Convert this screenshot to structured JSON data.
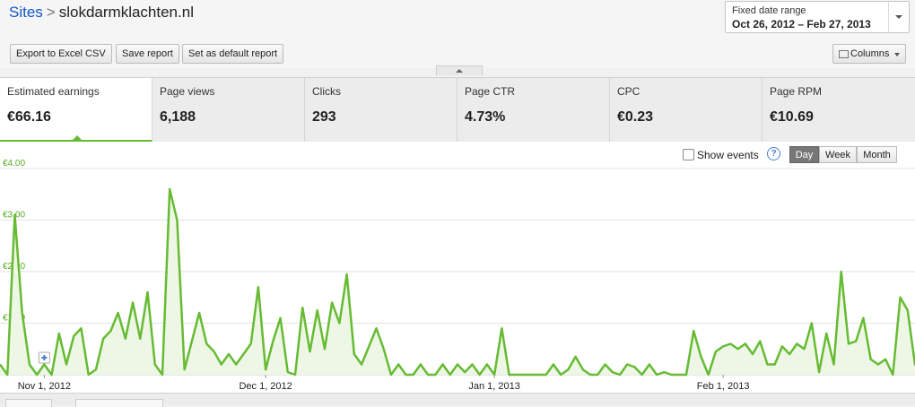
{
  "breadcrumb": {
    "root": "Sites",
    "separator": ">",
    "current": "slokdarmklachten.nl"
  },
  "date_range": {
    "label": "Fixed date range",
    "value": "Oct 26, 2012 – Feb 27, 2013"
  },
  "toolbar": {
    "export_label": "Export to Excel CSV",
    "save_label": "Save report",
    "default_label": "Set as default report",
    "columns_label": "Columns"
  },
  "metrics": [
    {
      "label": "Estimated earnings",
      "value": "€66.16",
      "active": true
    },
    {
      "label": "Page views",
      "value": "6,188",
      "active": false
    },
    {
      "label": "Clicks",
      "value": "293",
      "active": false
    },
    {
      "label": "Page CTR",
      "value": "4.73%",
      "active": false
    },
    {
      "label": "CPC",
      "value": "€0.23",
      "active": false
    },
    {
      "label": "Page RPM",
      "value": "€10.69",
      "active": false
    }
  ],
  "chart_controls": {
    "show_events_label": "Show events",
    "help_glyph": "?",
    "granularity": [
      "Day",
      "Week",
      "Month"
    ],
    "selected_granularity": "Day"
  },
  "colors": {
    "accent": "#66bb33",
    "fill": "#eef7e6",
    "link": "#1155cc"
  },
  "icons": {
    "help": "help-icon",
    "columns": "columns-icon",
    "dropdown": "chevron-down-icon",
    "collapse": "chevron-up-icon"
  },
  "chart_data": {
    "type": "area",
    "x_start": "2012-10-26",
    "x_end": "2013-02-27",
    "xtick_labels": [
      "Nov 1, 2012",
      "Dec 1, 2012",
      "Jan 1, 2013",
      "Feb 1, 2013"
    ],
    "xtick_dates": [
      "2012-11-01",
      "2012-12-01",
      "2013-01-01",
      "2013-02-01"
    ],
    "ytick_labels": [
      "€1.00",
      "€2.00",
      "€3.00",
      "€4.00"
    ],
    "ylim": [
      0,
      4.2
    ],
    "grid": true,
    "series": [
      {
        "values": [
          0.2,
          0,
          3.1,
          1.2,
          0.2,
          0,
          0.2,
          0,
          0.8,
          0.2,
          0.75,
          0.9,
          0,
          0.1,
          0.7,
          0.85,
          1.2,
          0.7,
          1.4,
          0.7,
          1.6,
          0.2,
          0,
          3.6,
          3.0,
          0.1,
          0.65,
          1.2,
          0.6,
          0.45,
          0.2,
          0.4,
          0.2,
          0.4,
          0.6,
          1.7,
          0.1,
          0.65,
          1.1,
          0.05,
          0,
          1.3,
          0.45,
          1.25,
          0.5,
          1.4,
          1.0,
          1.95,
          0.4,
          0.2,
          0.55,
          0.9,
          0.5,
          0,
          0.2,
          0,
          0,
          0.2,
          0,
          0,
          0.2,
          0,
          0.2,
          0.05,
          0.2,
          0,
          0.2,
          0,
          0.9,
          0,
          0,
          0,
          0,
          0,
          0,
          0.2,
          0,
          0.1,
          0.35,
          0.1,
          0,
          0,
          0.2,
          0.05,
          0,
          0.2,
          0.15,
          0,
          0.2,
          0,
          0.05,
          0,
          0,
          0,
          0.85,
          0.35,
          0,
          0.45,
          0.55,
          0.6,
          0.5,
          0.6,
          0.4,
          0.65,
          0.2,
          0.2,
          0.55,
          0.4,
          0.6,
          0.5,
          1.0,
          0.05,
          0.8,
          0.2,
          2.0,
          0.6,
          0.65,
          1.1,
          0.3,
          0.2,
          0.3,
          0,
          1.5,
          1.25,
          0.2,
          0.05
        ]
      }
    ]
  }
}
